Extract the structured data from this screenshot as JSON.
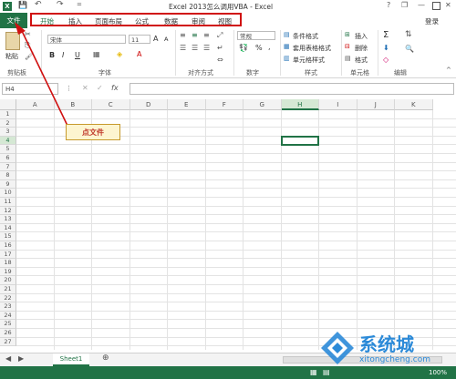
{
  "window": {
    "title": "Excel 2013怎么调用VBA - Excel",
    "help": "?",
    "minimize": "—",
    "restore": "❐",
    "close": "✕",
    "login": "登录"
  },
  "qat": {
    "save": "💾",
    "undo": "↶",
    "redo": "↷",
    "customize": "="
  },
  "tabs": {
    "file": "文件",
    "items": [
      "开始",
      "插入",
      "页面布局",
      "公式",
      "数据",
      "审阅",
      "视图"
    ]
  },
  "ribbon": {
    "clipboard": {
      "paste": "粘贴",
      "group": "剪贴板"
    },
    "font": {
      "name": "宋体",
      "size": "11",
      "grow": "A",
      "shrink": "A",
      "bold": "B",
      "italic": "I",
      "underline": "U",
      "group": "字体"
    },
    "alignment": {
      "group": "对齐方式"
    },
    "number": {
      "format": "常规",
      "percent": "%",
      "comma": ",",
      "group": "数字"
    },
    "styles": {
      "conditional": "条件格式",
      "table": "套用表格格式",
      "cell": "单元格样式",
      "group": "样式"
    },
    "cells": {
      "insert": "插入",
      "delete": "删除",
      "format": "格式",
      "group": "单元格"
    },
    "editing": {
      "sum": "Σ",
      "group": "编辑"
    }
  },
  "formula_bar": {
    "name_box": "H4",
    "cancel": "✕",
    "enter": "✓",
    "fx": "fx"
  },
  "grid": {
    "columns": [
      "A",
      "B",
      "C",
      "D",
      "E",
      "F",
      "G",
      "H",
      "I",
      "J",
      "K"
    ],
    "rows": [
      "1",
      "2",
      "3",
      "4",
      "5",
      "6",
      "7",
      "8",
      "9",
      "10",
      "11",
      "12",
      "13",
      "14",
      "15",
      "16",
      "17",
      "18",
      "19",
      "20",
      "21",
      "22",
      "23",
      "24",
      "25",
      "26",
      "27"
    ],
    "selected_column": "H",
    "selected_row": "4"
  },
  "annotation": {
    "text": "点文件"
  },
  "sheets": {
    "tabs": [
      "Sheet1"
    ],
    "add": "⊕"
  },
  "status": {
    "zoom": "100%"
  },
  "watermark": {
    "brand": "系统城",
    "url": "xitongcheng.com"
  }
}
